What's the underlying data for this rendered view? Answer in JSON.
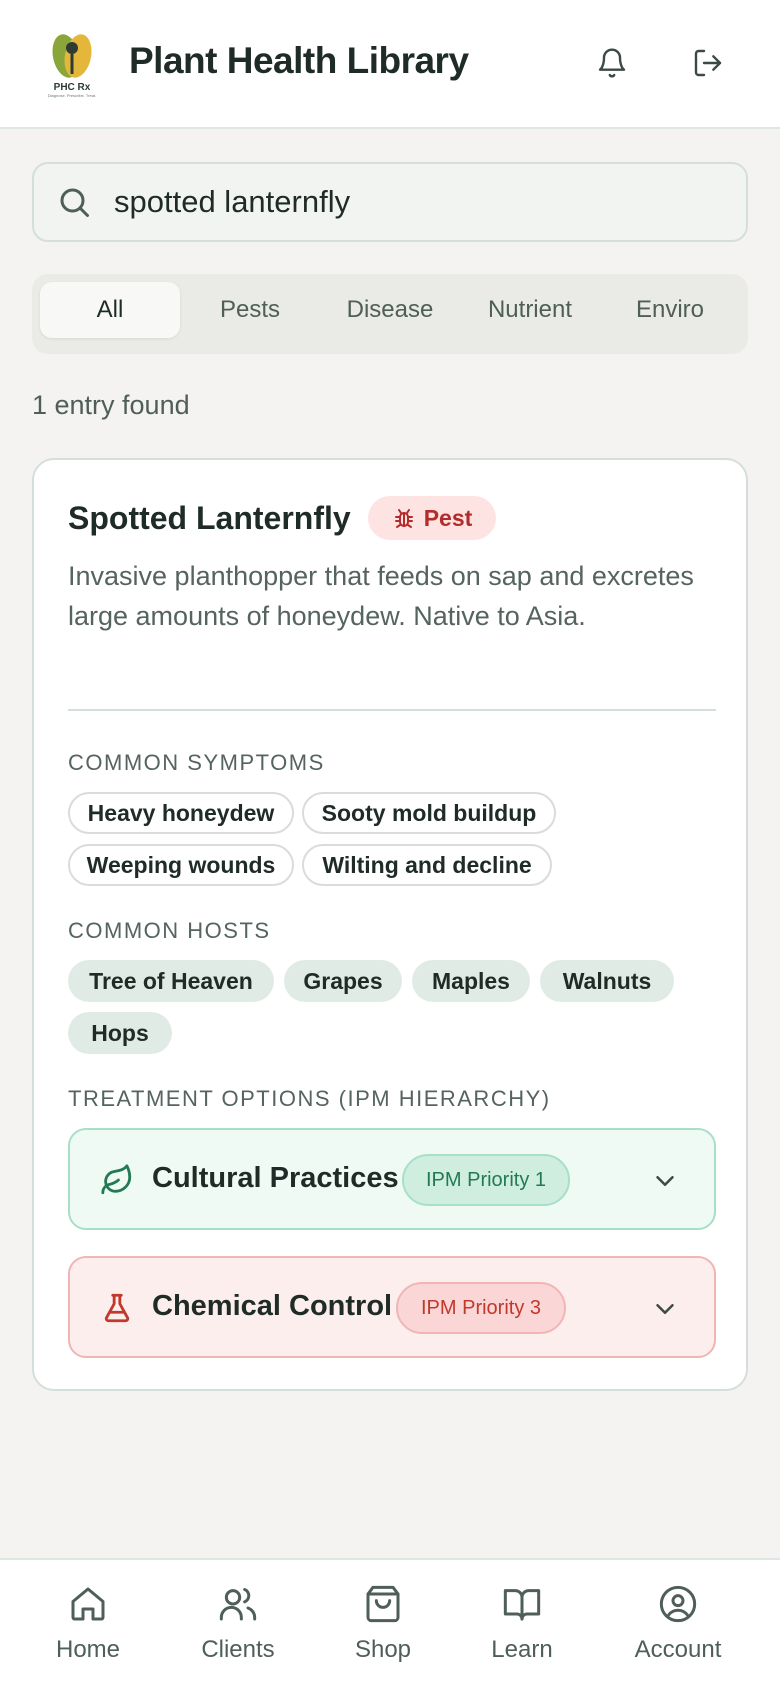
{
  "header": {
    "title": "Plant Health Library",
    "logo_text": "PHC Rx",
    "logo_tagline": "Diagnose. Prescribe. Treat.",
    "icons": [
      "bell-icon",
      "logout-icon"
    ]
  },
  "search": {
    "value": "spotted lanternfly",
    "placeholder": "",
    "icon": "search-icon"
  },
  "tabs": [
    {
      "label": "All",
      "active": true
    },
    {
      "label": "Pests",
      "active": false
    },
    {
      "label": "Disease",
      "active": false
    },
    {
      "label": "Nutrient",
      "active": false
    },
    {
      "label": "Enviro",
      "active": false
    }
  ],
  "results": {
    "count_text": "1 entry found"
  },
  "entry": {
    "title": "Spotted Lanternfly",
    "badge": "Pest",
    "badge_icon": "bug-icon",
    "description": "Invasive planthopper that feeds on sap and excretes large amounts of honeydew. Native to Asia.",
    "symptoms_label": "COMMON SYMPTOMS",
    "symptoms": [
      "Heavy honeydew",
      "Sooty mold buildup",
      "Weeping wounds",
      "Wilting and decline"
    ],
    "hosts_label": "COMMON HOSTS",
    "hosts": [
      "Tree of Heaven",
      "Grapes",
      "Maples",
      "Walnuts",
      "Hops"
    ],
    "treatments_label": "TREATMENT OPTIONS (IPM HIERARCHY)",
    "treatments": [
      {
        "name": "Cultural Practices",
        "priority": "IPM Priority 1",
        "icon": "leaf-icon",
        "color": "#227a55"
      },
      {
        "name": "Chemical Control",
        "priority": "IPM Priority 3",
        "icon": "flask-icon",
        "color": "#c0392b"
      }
    ]
  },
  "bottom_nav": [
    {
      "label": "Home",
      "icon": "home-icon"
    },
    {
      "label": "Clients",
      "icon": "users-icon"
    },
    {
      "label": "Shop",
      "icon": "shopping-bag-icon"
    },
    {
      "label": "Learn",
      "icon": "book-icon"
    },
    {
      "label": "Account",
      "icon": "user-circle-icon"
    }
  ],
  "colors": {
    "accent_green": "#227a55",
    "pest_red": "#b42b2b",
    "background": "#f4f3f1"
  }
}
